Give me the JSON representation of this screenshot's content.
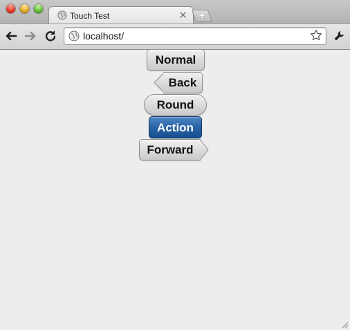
{
  "window": {
    "tab_title": "Touch Test",
    "new_tab_label": "+"
  },
  "toolbar": {
    "url": "localhost/",
    "back_icon": "back-arrow-icon",
    "forward_icon": "forward-arrow-icon",
    "reload_icon": "reload-icon",
    "bookmark_icon": "star-icon",
    "settings_icon": "wrench-icon"
  },
  "buttons": {
    "normal": "Normal",
    "back": "Back",
    "round": "Round",
    "action": "Action",
    "forward": "Forward"
  },
  "colors": {
    "page_background": "#ededed",
    "action_button": "#2a64a7",
    "button_gray": "#dcdcdc"
  }
}
